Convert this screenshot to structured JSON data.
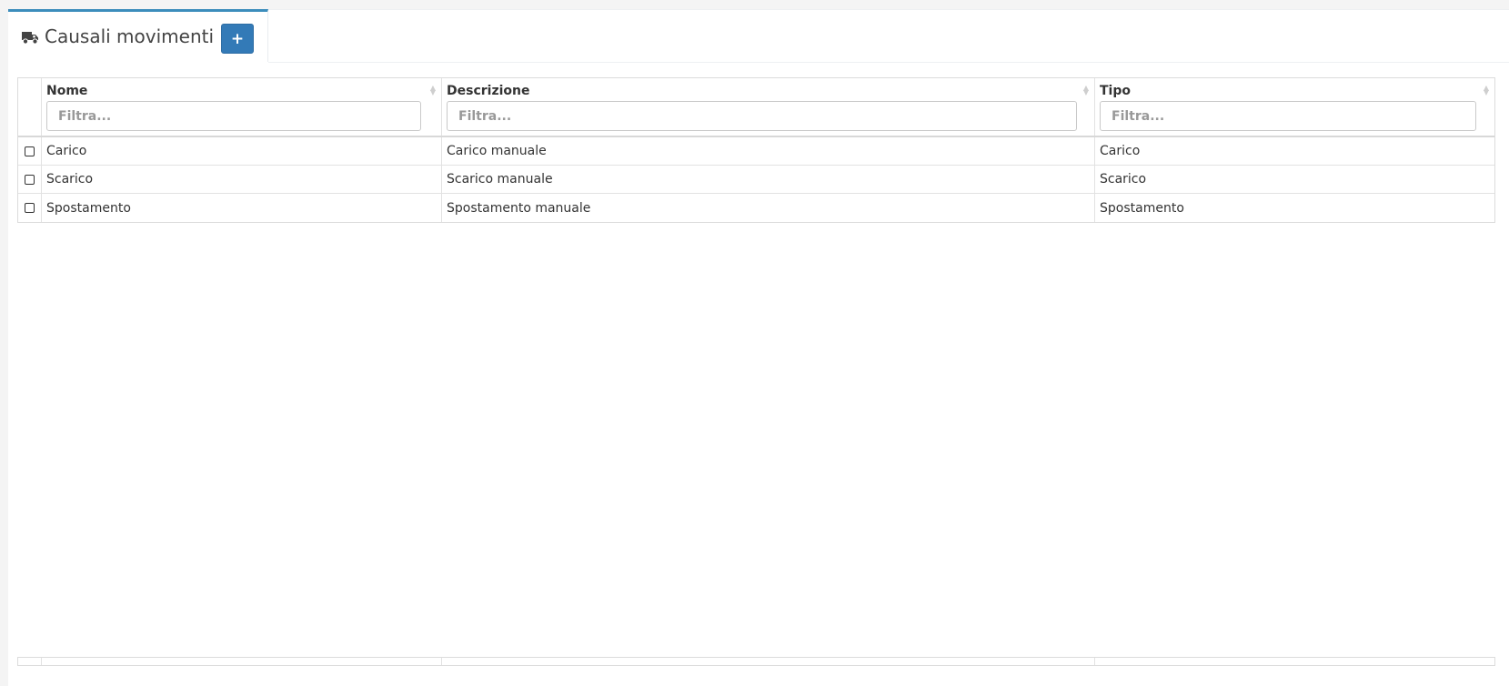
{
  "header": {
    "title": "Causali movimenti",
    "icon": "truck-icon",
    "add_label": "+",
    "accent_color": "#3c8dbc",
    "button_color": "#337ab7"
  },
  "table": {
    "columns": [
      {
        "label": "Nome",
        "placeholder": "Filtra..."
      },
      {
        "label": "Descrizione",
        "placeholder": "Filtra..."
      },
      {
        "label": "Tipo",
        "placeholder": "Filtra..."
      }
    ],
    "rows": [
      {
        "nome": "Carico",
        "descrizione": "Carico manuale",
        "tipo": "Carico"
      },
      {
        "nome": "Scarico",
        "descrizione": "Scarico manuale",
        "tipo": "Scarico"
      },
      {
        "nome": "Spostamento",
        "descrizione": "Spostamento manuale",
        "tipo": "Spostamento"
      }
    ]
  }
}
